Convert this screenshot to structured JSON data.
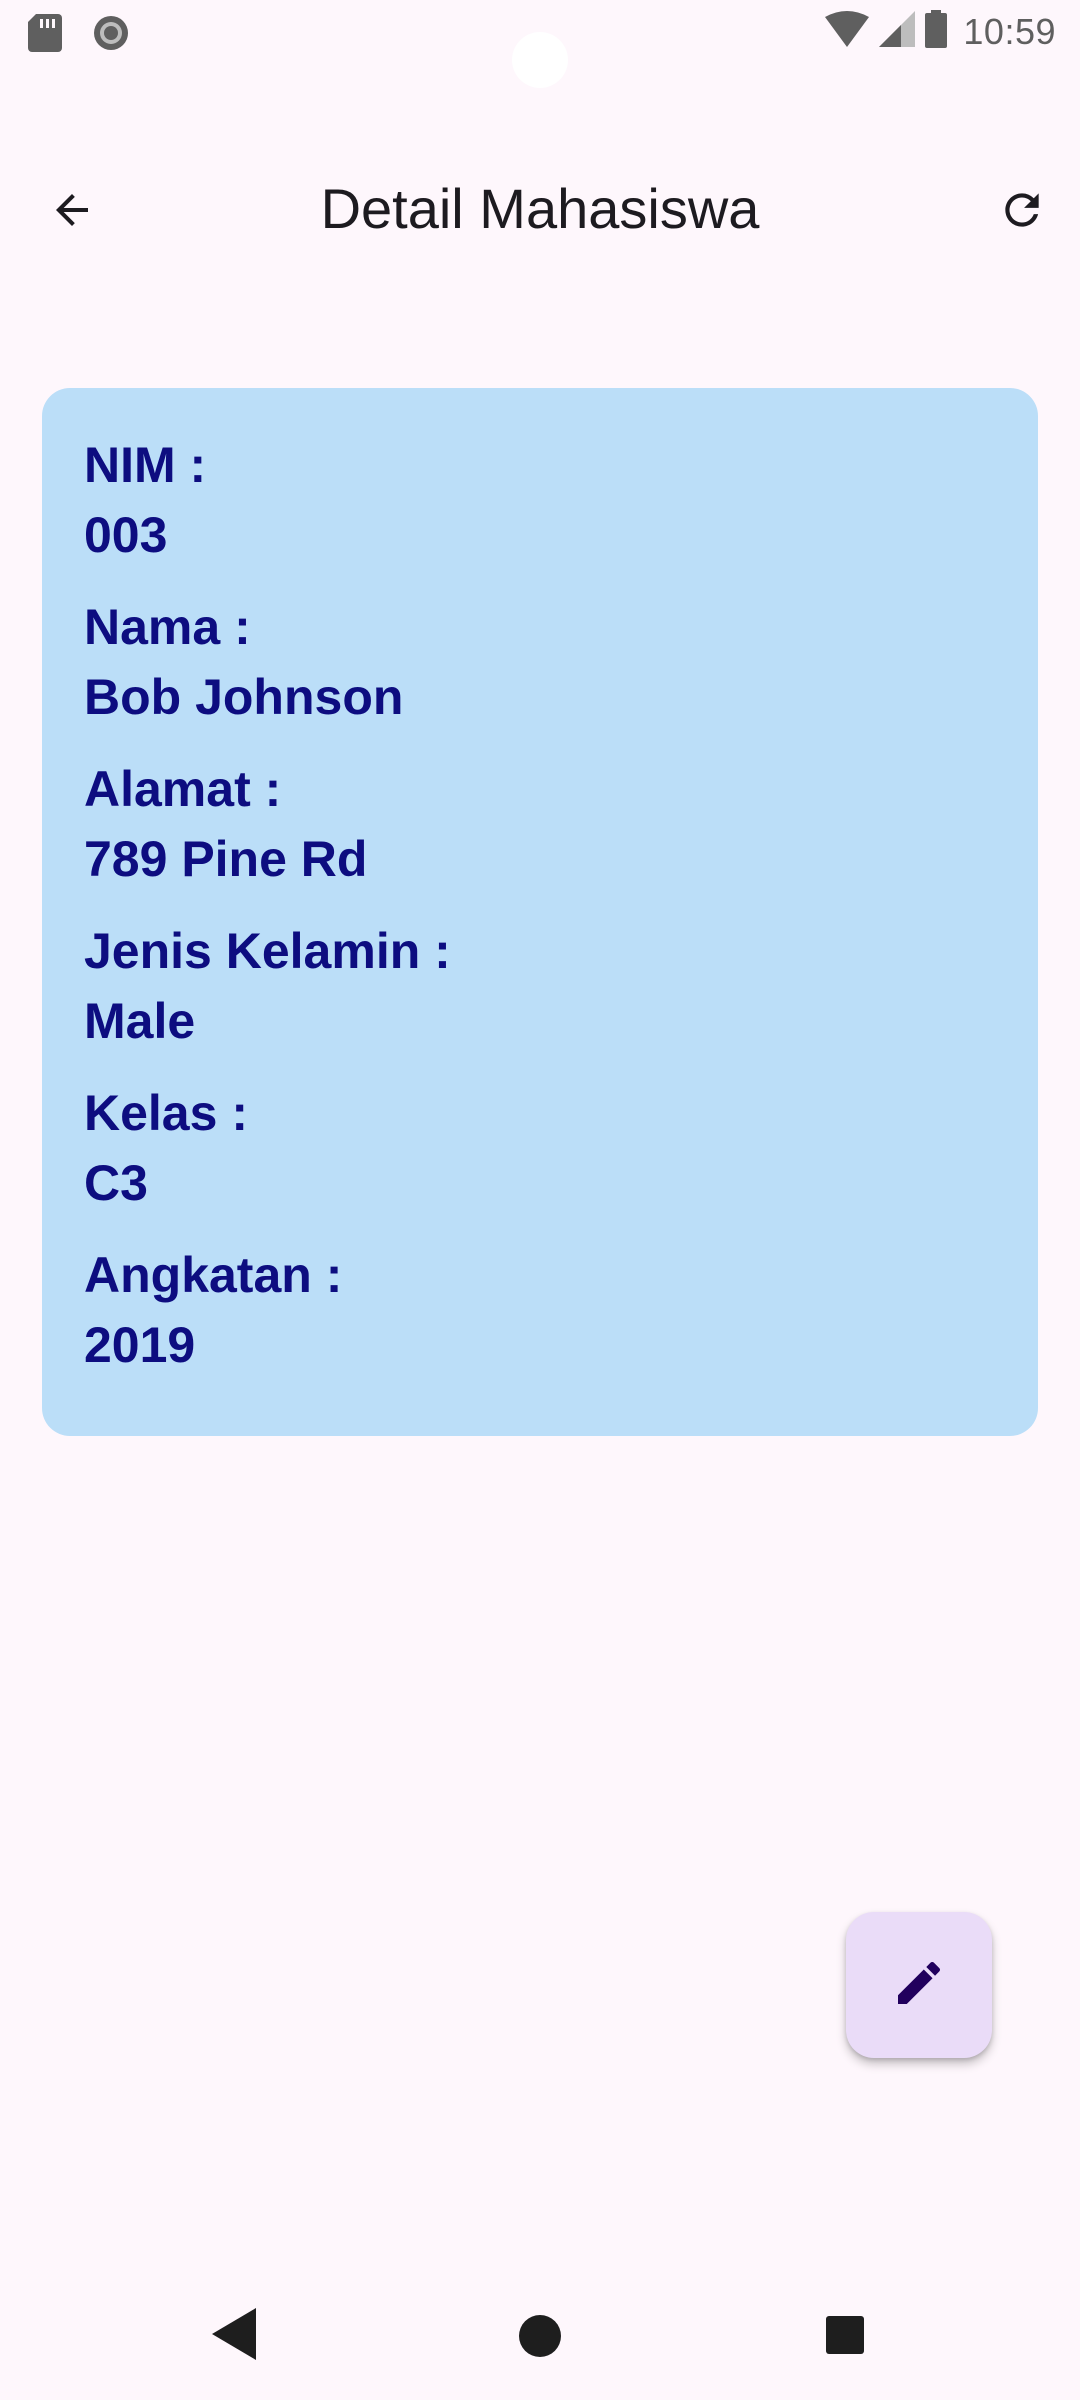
{
  "status_bar": {
    "time": "10:59",
    "left_icons": [
      "sd-card-icon",
      "record-icon"
    ],
    "right_icons": [
      "wifi-icon",
      "cell-signal-icon",
      "battery-icon"
    ]
  },
  "app_bar": {
    "title": "Detail Mahasiswa",
    "back_icon": "arrow-back-icon",
    "refresh_icon": "refresh-icon"
  },
  "student": {
    "fields": [
      {
        "label": "NIM :",
        "value": "003"
      },
      {
        "label": "Nama :",
        "value": "Bob Johnson"
      },
      {
        "label": "Alamat :",
        "value": "789 Pine Rd"
      },
      {
        "label": "Jenis Kelamin :",
        "value": "Male"
      },
      {
        "label": "Kelas :",
        "value": "C3"
      },
      {
        "label": "Angkatan :",
        "value": "2019"
      }
    ]
  },
  "fab": {
    "icon": "edit-pencil-icon"
  },
  "nav_bar": {
    "icons": [
      "nav-back-icon",
      "nav-home-icon",
      "nav-recents-icon"
    ]
  },
  "colors": {
    "background": "#fef7fc",
    "card": "#bbdef8",
    "card_text": "#0d0d80",
    "fab": "#eadcf8",
    "fab_icon": "#21005d"
  }
}
